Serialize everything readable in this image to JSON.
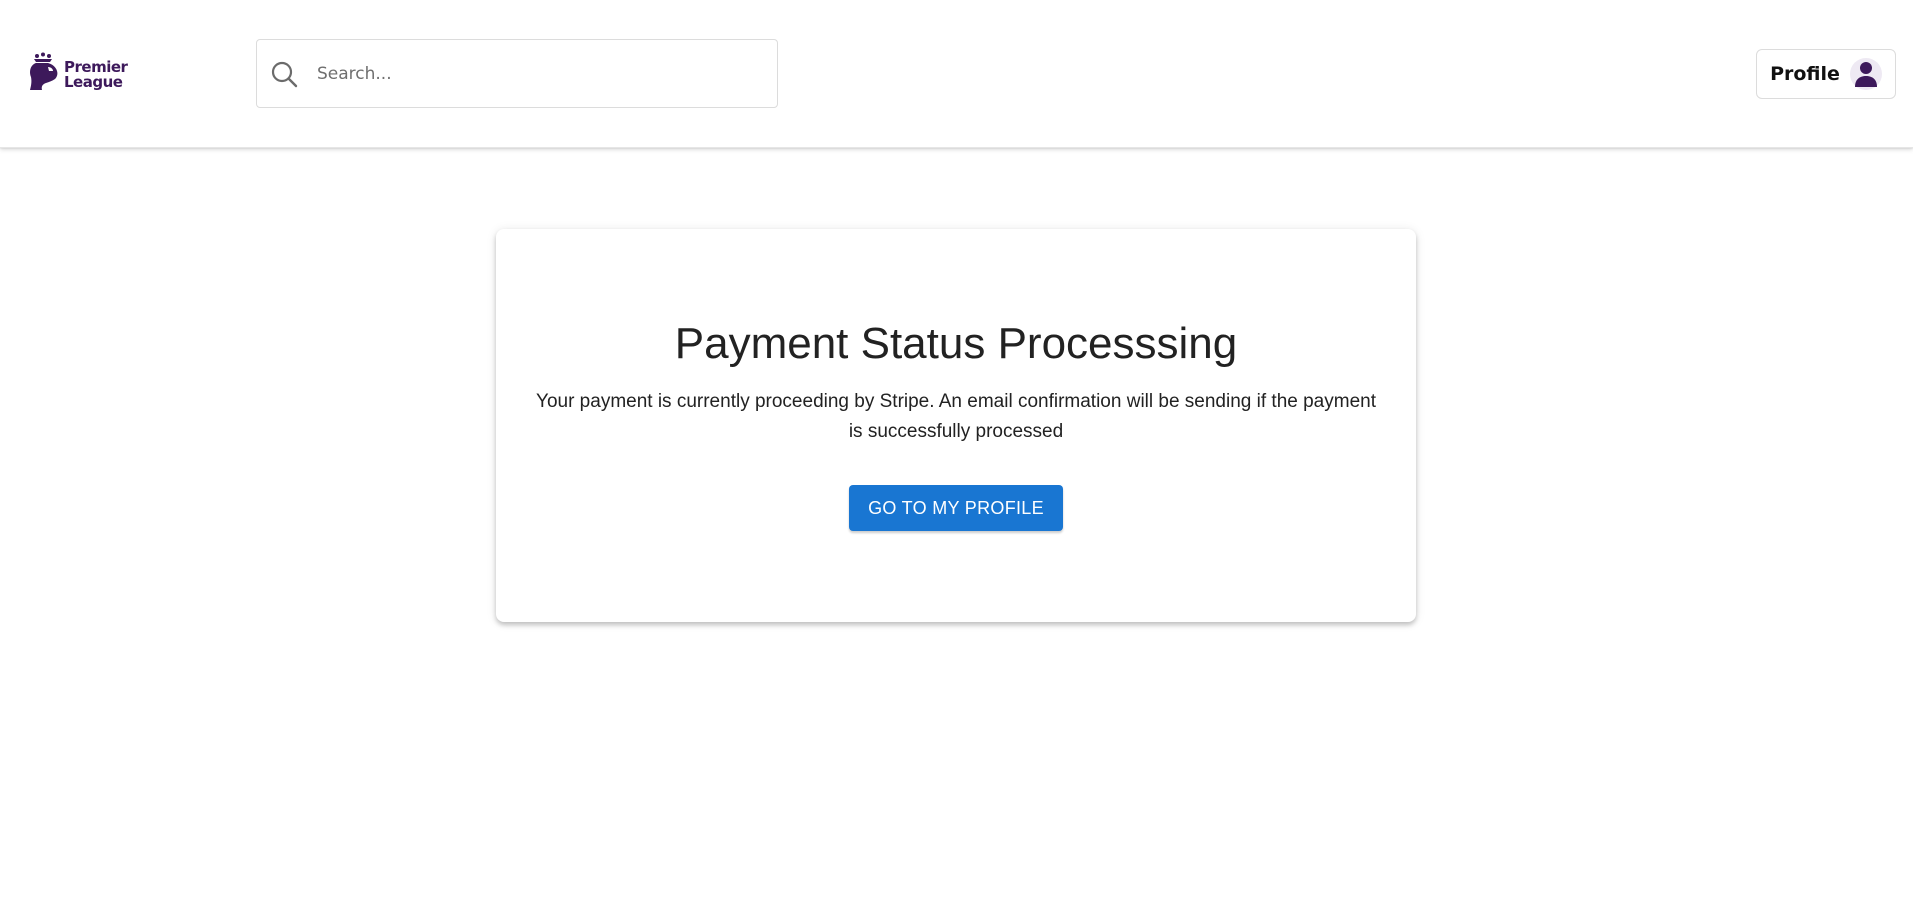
{
  "header": {
    "logo": {
      "line1": "Premier",
      "line2": "League",
      "color": "#3d195b"
    },
    "search": {
      "placeholder": "Search...",
      "value": "",
      "icon": "search-icon"
    },
    "profile_button": {
      "label": "Profile",
      "icon": "user-icon"
    }
  },
  "main": {
    "title": "Payment Status Processsing",
    "message": "Your payment is currently proceeding by Stripe. An email confirmation will be sending if the payment is successfully processed",
    "button_label": "GO TO MY PROFILE"
  },
  "colors": {
    "brand": "#3d195b",
    "primary": "#1976d2"
  }
}
